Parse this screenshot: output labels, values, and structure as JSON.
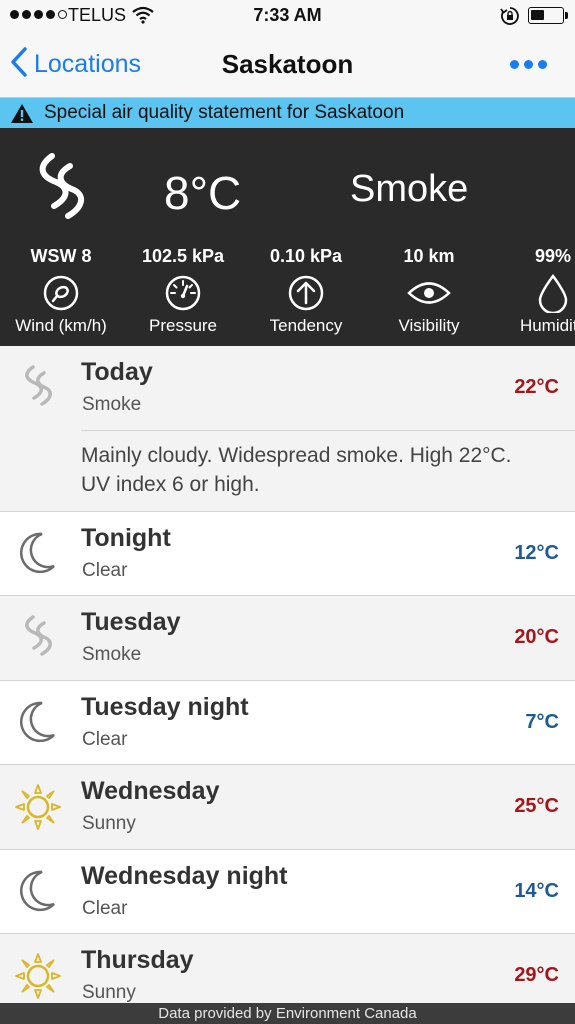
{
  "status_bar": {
    "carrier": "TELUS",
    "time": "7:33 AM",
    "battery_level": 0.45
  },
  "nav": {
    "back_label": "Locations",
    "title": "Saskatoon"
  },
  "alert": {
    "text": "Special air quality statement for Saskatoon"
  },
  "current": {
    "icon": "smoke-icon",
    "temperature": "8°C",
    "condition": "Smoke",
    "stats": [
      {
        "value": "WSW 8",
        "label": "Wind (km/h)",
        "icon": "wind-dial-icon"
      },
      {
        "value": "102.5 kPa",
        "label": "Pressure",
        "icon": "pressure-gauge-icon"
      },
      {
        "value": "0.10 kPa",
        "label": "Tendency",
        "icon": "arrow-up-circle-icon"
      },
      {
        "value": "10 km",
        "label": "Visibility",
        "icon": "eye-icon"
      },
      {
        "value": "99%",
        "label": "Humidity",
        "icon": "water-drop-icon"
      }
    ]
  },
  "forecast": [
    {
      "title": "Today",
      "subtitle": "Smoke",
      "temp": "22°C",
      "temp_kind": "high",
      "icon": "smoke-icon",
      "detail": "Mainly cloudy. Widespread smoke. High 22°C. UV index 6 or high."
    },
    {
      "title": "Tonight",
      "subtitle": "Clear",
      "temp": "12°C",
      "temp_kind": "low",
      "icon": "moon-icon"
    },
    {
      "title": "Tuesday",
      "subtitle": "Smoke",
      "temp": "20°C",
      "temp_kind": "high",
      "icon": "smoke-icon"
    },
    {
      "title": "Tuesday night",
      "subtitle": "Clear",
      "temp": "7°C",
      "temp_kind": "low",
      "icon": "moon-icon"
    },
    {
      "title": "Wednesday",
      "subtitle": "Sunny",
      "temp": "25°C",
      "temp_kind": "high",
      "icon": "sun-icon"
    },
    {
      "title": "Wednesday night",
      "subtitle": "Clear",
      "temp": "14°C",
      "temp_kind": "low",
      "icon": "moon-icon"
    },
    {
      "title": "Thursday",
      "subtitle": "Sunny",
      "temp": "29°C",
      "temp_kind": "high",
      "icon": "sun-icon"
    }
  ],
  "footer": {
    "text": "Data provided by Environment Canada"
  },
  "colors": {
    "accent": "#1a7cf0",
    "alert_bg": "#5bc4f0",
    "high_temp": "#a5161b",
    "low_temp": "#1f5a96",
    "current_bg": "#2a2a2a"
  }
}
